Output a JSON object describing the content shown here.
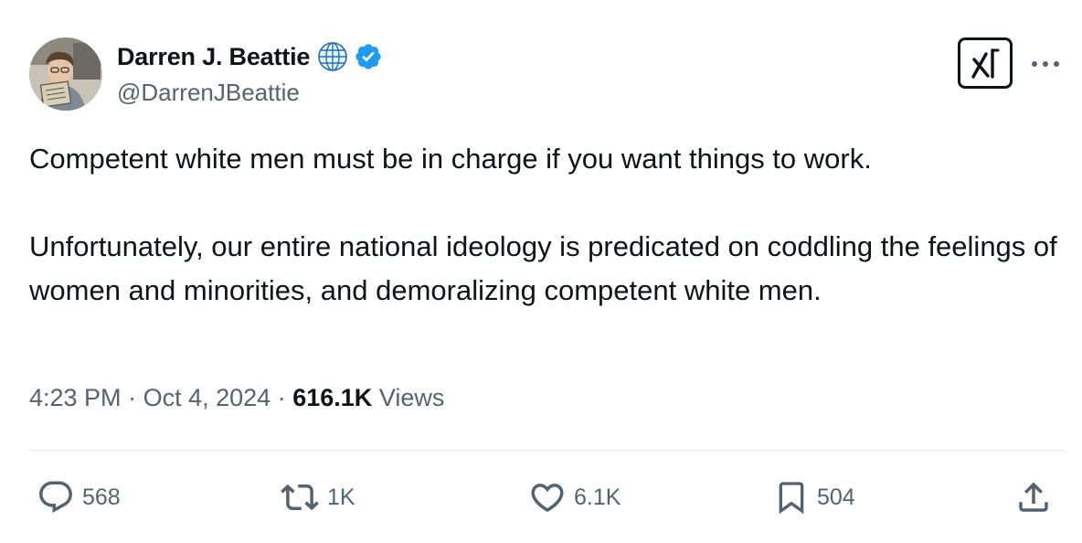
{
  "author": {
    "display_name": "Darren J. Beattie",
    "handle": "@DarrenJBeattie",
    "badges": [
      "globe-icon",
      "verified-badge-icon"
    ],
    "verified_color": "#1d9bf0"
  },
  "tweet": {
    "paragraphs": [
      "Competent white men must be in charge if you want things to work.",
      "Unfortunately, our entire national ideology is predicated on coddling the feelings of women and minorities, and demoralizing competent white men."
    ],
    "time": "4:23 PM",
    "date": "Oct 4, 2024",
    "views_count": "616.1K",
    "views_label": "Views",
    "separator": "·"
  },
  "actions": {
    "reply_count": "568",
    "retweet_count": "1K",
    "like_count": "6.1K",
    "bookmark_count": "504"
  },
  "colors": {
    "text_primary": "#0f1419",
    "text_secondary": "#536471",
    "divider": "#e6e9eb"
  }
}
